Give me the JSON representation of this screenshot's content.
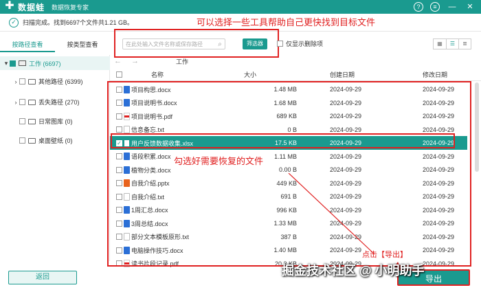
{
  "app": {
    "name": "数据蛙",
    "subtitle": "数据恢复专家",
    "brand_color": "#1a9a8f"
  },
  "window_buttons": [
    "?",
    "≡",
    "—",
    "✕"
  ],
  "scan": {
    "status": "扫描完成。找到6697个文件共1.21 GB。"
  },
  "annotations": {
    "top_hint": "可以选择一些工具帮助自己更快找到目标文件",
    "mid_hint": "勾选好需要恢复的文件",
    "export_hint": "点击【导出】",
    "color": "#e02020"
  },
  "tabs": [
    "按路径查看",
    "按类型查看"
  ],
  "search": {
    "placeholder": "在此处输入文件名称或保存路径"
  },
  "filter_button": "筛选器",
  "show_deleted_label": "仅显示删除项",
  "tree": [
    {
      "label": "工作 (6697)",
      "level": 0,
      "checked": true,
      "expanded": true
    },
    {
      "label": "其他路径 (6399)",
      "level": 1,
      "checked": false,
      "expanded": false
    },
    {
      "label": "丢失路径 (270)",
      "level": 1,
      "checked": false,
      "expanded": false
    },
    {
      "label": "日常图库 (0)",
      "level": 1,
      "checked": false,
      "expanded": null
    },
    {
      "label": "桌面壁纸 (0)",
      "level": 1,
      "checked": false,
      "expanded": null
    }
  ],
  "breadcrumb": "工作",
  "table": {
    "headers": [
      "名称",
      "大小",
      "创建日期",
      "修改日期"
    ],
    "rows": [
      {
        "name": "项目构思.docx",
        "size": "1.48 MB",
        "created": "2024-09-29",
        "modified": "2024-09-29",
        "type": "docx",
        "checked": false
      },
      {
        "name": "项目说明书.docx",
        "size": "1.68 MB",
        "created": "2024-09-29",
        "modified": "2024-09-29",
        "type": "docx",
        "checked": false
      },
      {
        "name": "项目说明书.pdf",
        "size": "689 KB",
        "created": "2024-09-29",
        "modified": "2024-09-29",
        "type": "pdf",
        "checked": false
      },
      {
        "name": "信息备忘.txt",
        "size": "0 B",
        "created": "2024-09-29",
        "modified": "2024-09-29",
        "type": "txt",
        "checked": false
      },
      {
        "name": "用户反馈数据收集.xlsx",
        "size": "17.5 KB",
        "created": "2024-09-29",
        "modified": "2024-09-29",
        "type": "xlsx",
        "checked": true
      },
      {
        "name": "语段积累.docx",
        "size": "1.11 MB",
        "created": "2024-09-29",
        "modified": "2024-09-29",
        "type": "docx",
        "checked": false
      },
      {
        "name": "植物分类.docx",
        "size": "0.00 B",
        "created": "2024-09-29",
        "modified": "2024-09-29",
        "type": "docx",
        "checked": false
      },
      {
        "name": "自我介绍.pptx",
        "size": "449 KB",
        "created": "2024-09-29",
        "modified": "2024-09-29",
        "type": "pptx",
        "checked": false
      },
      {
        "name": "自我介绍.txt",
        "size": "691 B",
        "created": "2024-09-29",
        "modified": "2024-09-29",
        "type": "txt",
        "checked": false
      },
      {
        "name": "1周汇总.docx",
        "size": "996 KB",
        "created": "2024-09-29",
        "modified": "2024-09-29",
        "type": "docx",
        "checked": false
      },
      {
        "name": "3周总结.docx",
        "size": "1.33 MB",
        "created": "2024-09-29",
        "modified": "2024-09-29",
        "type": "docx",
        "checked": false
      },
      {
        "name": "部分文本模板原形.txt",
        "size": "387 B",
        "created": "2024-09-29",
        "modified": "2024-09-29",
        "type": "txt",
        "checked": false
      },
      {
        "name": "电脑操作技巧.docx",
        "size": "1.40 MB",
        "created": "2024-09-29",
        "modified": "2024-09-29",
        "type": "docx",
        "checked": false
      },
      {
        "name": "读书片段记录.pdf",
        "size": "20.3 KB",
        "created": "2024-09-29",
        "modified": "2024-09-29",
        "type": "pdf",
        "checked": false
      }
    ]
  },
  "footer": {
    "back_label": "返回",
    "export_label": "导出"
  },
  "watermark": "掘金技术社区 @ 小明助手"
}
